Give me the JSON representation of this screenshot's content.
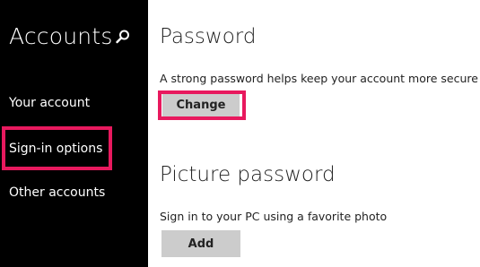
{
  "sidebar": {
    "title": "Accounts",
    "search_icon": "search-icon",
    "items": [
      {
        "label": "Your account"
      },
      {
        "label": "Sign-in options"
      },
      {
        "label": "Other accounts"
      }
    ]
  },
  "password": {
    "title": "Password",
    "description": "A strong password helps keep your account more secure",
    "button_label": "Change"
  },
  "picture_password": {
    "title": "Picture password",
    "description": "Sign in to your PC using a favorite photo",
    "button_label": "Add"
  },
  "colors": {
    "sidebar_bg": "#000000",
    "highlight": "#e8195e",
    "button_bg": "#cccccc"
  }
}
